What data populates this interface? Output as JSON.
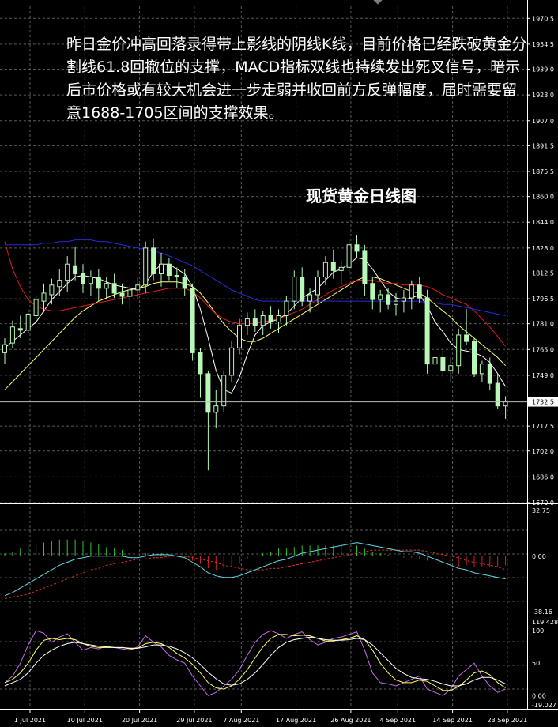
{
  "annotation": "昨日金价冲高回落录得带上影线的阴线K线，目前价格已经跌破黄金分割线61.8回撤位的支撑，MACD指标双线也持续发出死叉信号，暗示后市价格或有较大机会进一步走弱并收回前方反弹幅度，届时需要留意1688-1705区间的支撑效果。",
  "colors": {
    "background": "#000000",
    "grid": "#5a5a5a",
    "candle": "#b8f7b8",
    "price_tag_bg": "#ffffff",
    "ma_fast": "#ffffff",
    "ma_mid": "#ffff66",
    "ma_slow": "#e01e1e",
    "ma_long": "#2a2ad8",
    "macd_signal": "#e03030",
    "macd_main": "#5fd8e8",
    "hist_pos": "#2ec42e",
    "hist_neg": "#e01e1e",
    "kdj_k": "#c86ee8",
    "kdj_d": "#ffff66",
    "kdj_j": "#ffffff"
  },
  "chart_data": [
    {
      "type": "candlestick",
      "title": "现货黄金日线图",
      "y_ticks": [
        1970.5,
        1954.5,
        1939.0,
        1923.0,
        1907.0,
        1891.5,
        1875.5,
        1860.0,
        1844.0,
        1828.0,
        1812.5,
        1796.5,
        1781.0,
        1765.0,
        1749.0,
        1717.5,
        1702.0,
        1686.0,
        1670.0
      ],
      "ylim": [
        1670.0,
        1978.0
      ],
      "current_price": 1732.5,
      "x_ticks": [
        "1 Jul 2021",
        "10 Jul 2021",
        "20 Jul 2021",
        "29 Jul 2021",
        "7 Aug 2021",
        "17 Aug 2021",
        "26 Aug 2021",
        "4 Sep 2021",
        "14 Sep 2021",
        "23 Sep 2021"
      ],
      "candles": [
        [
          1763,
          1772,
          1756,
          1768
        ],
        [
          1769,
          1783,
          1766,
          1779
        ],
        [
          1778,
          1786,
          1772,
          1777
        ],
        [
          1777,
          1790,
          1775,
          1787
        ],
        [
          1786,
          1799,
          1782,
          1796
        ],
        [
          1795,
          1806,
          1788,
          1800
        ],
        [
          1799,
          1809,
          1793,
          1805
        ],
        [
          1804,
          1815,
          1798,
          1808
        ],
        [
          1808,
          1823,
          1801,
          1818
        ],
        [
          1817,
          1829,
          1808,
          1812
        ],
        [
          1812,
          1818,
          1800,
          1806
        ],
        [
          1806,
          1814,
          1798,
          1810
        ],
        [
          1810,
          1815,
          1795,
          1803
        ],
        [
          1803,
          1810,
          1796,
          1806
        ],
        [
          1806,
          1812,
          1797,
          1800
        ],
        [
          1800,
          1806,
          1793,
          1798
        ],
        [
          1798,
          1805,
          1790,
          1802
        ],
        [
          1802,
          1810,
          1796,
          1805
        ],
        [
          1805,
          1832,
          1800,
          1828
        ],
        [
          1828,
          1834,
          1808,
          1812
        ],
        [
          1812,
          1825,
          1804,
          1818
        ],
        [
          1818,
          1822,
          1808,
          1811
        ],
        [
          1811,
          1816,
          1803,
          1810
        ],
        [
          1810,
          1815,
          1798,
          1803
        ],
        [
          1803,
          1806,
          1758,
          1763
        ],
        [
          1763,
          1766,
          1735,
          1750
        ],
        [
          1750,
          1752,
          1690,
          1726
        ],
        [
          1726,
          1740,
          1716,
          1730
        ],
        [
          1730,
          1752,
          1726,
          1749
        ],
        [
          1749,
          1770,
          1745,
          1766
        ],
        [
          1766,
          1784,
          1762,
          1780
        ],
        [
          1780,
          1788,
          1774,
          1784
        ],
        [
          1784,
          1790,
          1776,
          1780
        ],
        [
          1780,
          1789,
          1774,
          1786
        ],
        [
          1786,
          1792,
          1778,
          1782
        ],
        [
          1782,
          1790,
          1775,
          1786
        ],
        [
          1786,
          1798,
          1780,
          1795
        ],
        [
          1795,
          1814,
          1790,
          1810
        ],
        [
          1810,
          1816,
          1792,
          1795
        ],
        [
          1795,
          1803,
          1788,
          1799
        ],
        [
          1799,
          1814,
          1794,
          1810
        ],
        [
          1810,
          1823,
          1805,
          1819
        ],
        [
          1819,
          1827,
          1809,
          1814
        ],
        [
          1814,
          1820,
          1805,
          1816
        ],
        [
          1816,
          1834,
          1811,
          1830
        ],
        [
          1830,
          1836,
          1822,
          1826
        ],
        [
          1826,
          1830,
          1798,
          1806
        ],
        [
          1806,
          1810,
          1790,
          1796
        ],
        [
          1796,
          1802,
          1788,
          1799
        ],
        [
          1799,
          1803,
          1790,
          1793
        ],
        [
          1793,
          1800,
          1786,
          1795
        ],
        [
          1795,
          1802,
          1788,
          1797
        ],
        [
          1797,
          1808,
          1790,
          1805
        ],
        [
          1805,
          1810,
          1794,
          1797
        ],
        [
          1797,
          1802,
          1750,
          1756
        ],
        [
          1756,
          1765,
          1745,
          1760
        ],
        [
          1760,
          1766,
          1748,
          1752
        ],
        [
          1752,
          1760,
          1745,
          1755
        ],
        [
          1755,
          1778,
          1750,
          1774
        ],
        [
          1774,
          1790,
          1768,
          1770
        ],
        [
          1770,
          1772,
          1748,
          1750
        ],
        [
          1750,
          1758,
          1745,
          1756
        ],
        [
          1756,
          1760,
          1740,
          1744
        ],
        [
          1744,
          1750,
          1728,
          1730
        ],
        [
          1730,
          1736,
          1722,
          1732.5
        ]
      ],
      "moving_averages": [
        {
          "values": [
            1766,
            1770,
            1774,
            1778,
            1782,
            1789,
            1796,
            1801,
            1806,
            1810,
            1811,
            1810,
            1809,
            1807,
            1805,
            1804,
            1803,
            1802,
            1806,
            1813,
            1818,
            1818,
            1815,
            1812,
            1804,
            1790,
            1772,
            1752,
            1740,
            1738,
            1748,
            1762,
            1774,
            1780,
            1782,
            1784,
            1787,
            1792,
            1797,
            1800,
            1803,
            1808,
            1813,
            1815,
            1818,
            1822,
            1821,
            1815,
            1808,
            1801,
            1797,
            1796,
            1797,
            1799,
            1792,
            1782,
            1776,
            1769,
            1765,
            1764,
            1763,
            1761,
            1757,
            1750,
            1742
          ]
        },
        {
          "values": [
            1740,
            1745,
            1750,
            1755,
            1760,
            1765,
            1770,
            1775,
            1780,
            1785,
            1789,
            1792,
            1795,
            1797,
            1799,
            1801,
            1802,
            1803,
            1804,
            1806,
            1807,
            1807,
            1807,
            1806,
            1804,
            1800,
            1794,
            1787,
            1781,
            1776,
            1772,
            1770,
            1770,
            1772,
            1775,
            1778,
            1781,
            1784,
            1787,
            1790,
            1793,
            1796,
            1799,
            1802,
            1805,
            1808,
            1810,
            1810,
            1809,
            1807,
            1805,
            1803,
            1801,
            1800,
            1797,
            1793,
            1789,
            1785,
            1780,
            1776,
            1772,
            1768,
            1764,
            1760,
            1755
          ]
        },
        {
          "values": [
            1832,
            1815,
            1804,
            1796,
            1792,
            1790,
            1789,
            1789,
            1790,
            1791,
            1792,
            1793,
            1794,
            1795,
            1796,
            1797,
            1798,
            1799,
            1800,
            1801,
            1802,
            1803,
            1803,
            1803,
            1801,
            1797,
            1792,
            1787,
            1784,
            1782,
            1781,
            1781,
            1781,
            1782,
            1783,
            1784,
            1786,
            1788,
            1790,
            1793,
            1796,
            1799,
            1802,
            1804,
            1806,
            1808,
            1808,
            1808,
            1807,
            1806,
            1806,
            1805,
            1805,
            1805,
            1804,
            1802,
            1799,
            1797,
            1795,
            1793,
            1789,
            1784,
            1779,
            1773,
            1767
          ]
        },
        {
          "values": [
            1830,
            1830,
            1830,
            1830,
            1830,
            1831,
            1831,
            1832,
            1832,
            1833,
            1833,
            1833,
            1832,
            1832,
            1831,
            1830,
            1829,
            1828,
            1827,
            1826,
            1825,
            1823,
            1821,
            1819,
            1817,
            1814,
            1811,
            1808,
            1805,
            1802,
            1800,
            1798,
            1796,
            1795,
            1795,
            1795,
            1795,
            1795,
            1795,
            1795,
            1795,
            1795,
            1795,
            1795,
            1795,
            1795,
            1795,
            1795,
            1795,
            1795,
            1795,
            1795,
            1795,
            1795,
            1794,
            1794,
            1793,
            1793,
            1792,
            1791,
            1790,
            1789,
            1788,
            1787,
            1786
          ]
        }
      ]
    },
    {
      "type": "macd",
      "y_ticks": [
        32.75,
        0.0,
        -38.16
      ],
      "ylim": [
        -38.16,
        32.75
      ],
      "main": [
        -26,
        -24,
        -21,
        -18,
        -15,
        -12,
        -9,
        -6,
        -4,
        -2,
        -1,
        0,
        0,
        0,
        0,
        0,
        -1,
        -1,
        0,
        1,
        1,
        1,
        0,
        -1,
        -4,
        -7,
        -11,
        -13,
        -14,
        -14,
        -13,
        -11,
        -9,
        -7,
        -5,
        -3,
        -2,
        0,
        2,
        3,
        4,
        5,
        6,
        7,
        8,
        9,
        8,
        7,
        6,
        5,
        4,
        3,
        3,
        2,
        0,
        -2,
        -4,
        -6,
        -8,
        -9,
        -11,
        -12,
        -13,
        -14,
        -15
      ],
      "signal": [
        -28,
        -27,
        -26,
        -25,
        -23,
        -21,
        -19,
        -17,
        -15,
        -13,
        -11,
        -9,
        -8,
        -6,
        -5,
        -4,
        -3,
        -2,
        -2,
        -1,
        -1,
        0,
        0,
        0,
        -1,
        -2,
        -3,
        -4,
        -6,
        -7,
        -8,
        -9,
        -9,
        -9,
        -8,
        -8,
        -7,
        -6,
        -5,
        -4,
        -3,
        -2,
        -1,
        0,
        1,
        2,
        3,
        4,
        4,
        4,
        4,
        4,
        4,
        4,
        3,
        2,
        1,
        0,
        -1,
        -3,
        -4,
        -5,
        -6,
        -7,
        -9
      ],
      "histogram": [
        2,
        3,
        5,
        7,
        8,
        9,
        10,
        11,
        11,
        11,
        10,
        9,
        8,
        6,
        5,
        4,
        2,
        1,
        2,
        2,
        2,
        1,
        0,
        -1,
        -3,
        -5,
        -8,
        -9,
        -8,
        -7,
        -5,
        -2,
        0,
        2,
        3,
        5,
        5,
        6,
        7,
        7,
        7,
        7,
        7,
        7,
        7,
        7,
        5,
        3,
        2,
        1,
        0,
        -1,
        -1,
        -2,
        -3,
        -4,
        -5,
        -6,
        -7,
        -6,
        -7,
        -7,
        -7,
        -7,
        -6
      ]
    },
    {
      "type": "line",
      "y_ticks": [
        119.428,
        100,
        50,
        0.0,
        -19.027
      ],
      "ylim": [
        -19.027,
        119.428
      ],
      "series": [
        {
          "values": [
            20,
            30,
            50,
            78,
            100,
            96,
            82,
            90,
            95,
            82,
            70,
            74,
            72,
            76,
            74,
            72,
            70,
            75,
            92,
            82,
            75,
            62,
            55,
            50,
            30,
            15,
            0,
            5,
            15,
            25,
            40,
            62,
            82,
            94,
            100,
            95,
            88,
            94,
            98,
            86,
            78,
            82,
            88,
            90,
            94,
            98,
            70,
            35,
            20,
            18,
            15,
            20,
            25,
            30,
            10,
            5,
            0,
            10,
            30,
            40,
            50,
            30,
            15,
            5,
            10
          ]
        },
        {
          "values": [
            20,
            25,
            35,
            50,
            70,
            85,
            88,
            86,
            88,
            86,
            80,
            76,
            74,
            74,
            74,
            74,
            72,
            73,
            80,
            82,
            80,
            74,
            65,
            58,
            48,
            35,
            20,
            12,
            10,
            15,
            25,
            40,
            58,
            75,
            88,
            94,
            94,
            92,
            93,
            92,
            88,
            84,
            84,
            86,
            88,
            92,
            86,
            70,
            50,
            35,
            24,
            20,
            20,
            24,
            22,
            15,
            8,
            8,
            14,
            24,
            35,
            38,
            32,
            20,
            12
          ]
        },
        {
          "values": [
            15,
            20,
            25,
            35,
            50,
            62,
            70,
            76,
            80,
            82,
            80,
            78,
            76,
            75,
            74,
            74,
            73,
            73,
            75,
            78,
            78,
            76,
            72,
            66,
            58,
            48,
            36,
            26,
            18,
            16,
            18,
            25,
            35,
            48,
            62,
            74,
            82,
            86,
            88,
            90,
            88,
            86,
            85,
            85,
            86,
            88,
            86,
            78,
            66,
            54,
            42,
            34,
            28,
            26,
            25,
            22,
            18,
            15,
            15,
            18,
            24,
            28,
            28,
            24,
            18
          ]
        }
      ]
    }
  ]
}
